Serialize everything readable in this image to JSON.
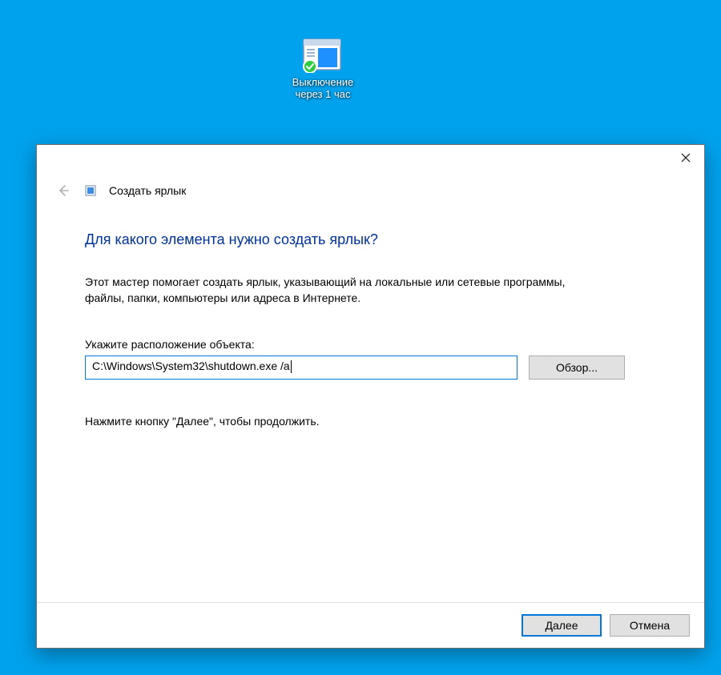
{
  "desktop": {
    "shortcut_label": "Выключение\nчерез 1 час"
  },
  "wizard": {
    "window_title": "Создать ярлык",
    "heading": "Для какого элемента нужно создать ярлык?",
    "description": "Этот мастер помогает создать ярлык, указывающий на локальные или сетевые программы, файлы, папки, компьютеры или адреса в Интернете.",
    "field_label": "Укажите расположение объекта:",
    "path_value": "C:\\Windows\\System32\\shutdown.exe /a",
    "browse_label": "Обзор...",
    "hint": "Нажмите кнопку \"Далее\", чтобы продолжить.",
    "next_label": "Далее",
    "cancel_label": "Отмена"
  }
}
